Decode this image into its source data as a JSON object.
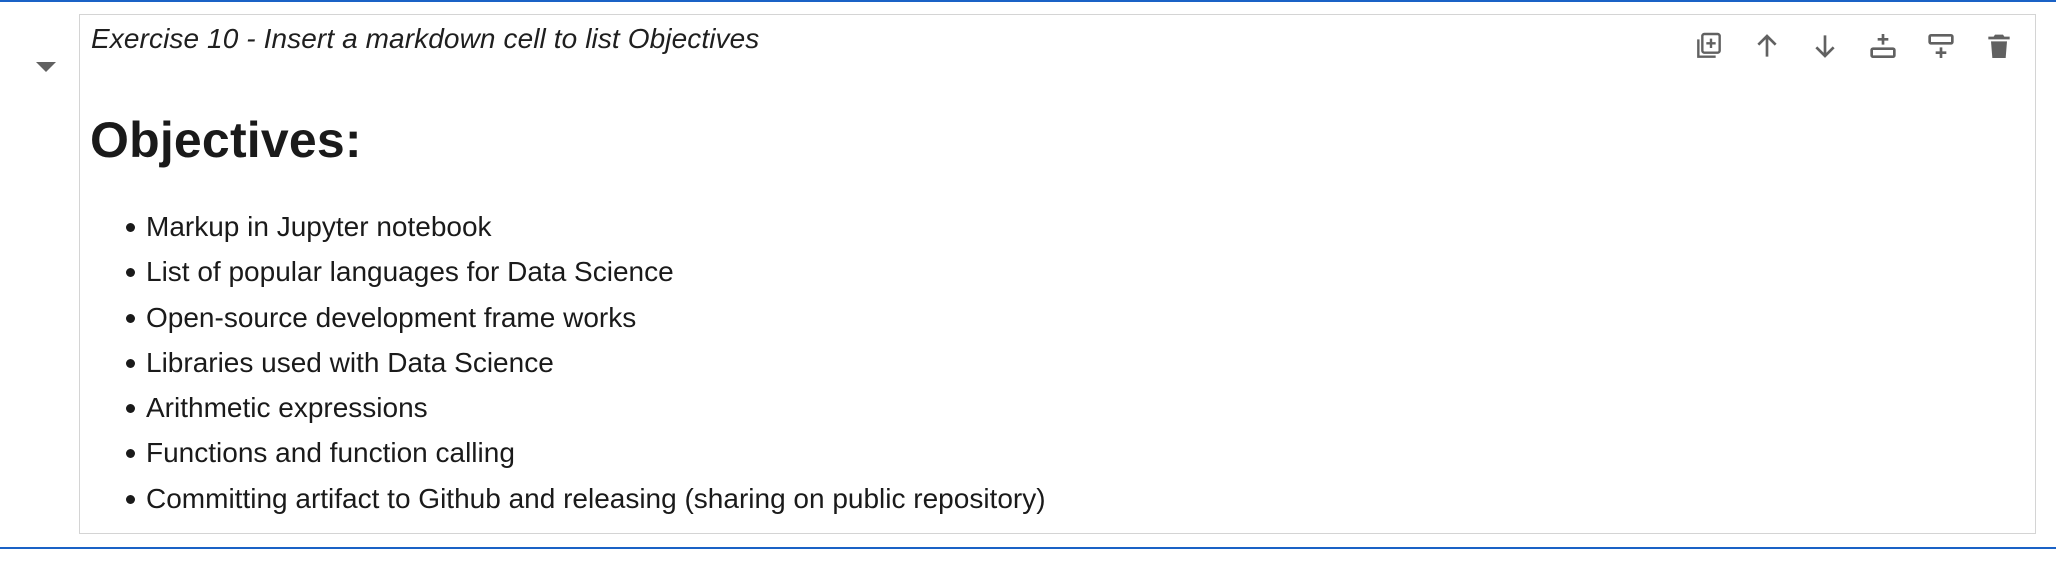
{
  "cell": {
    "heading": "Exercise 10 - Insert a markdown cell to list Objectives",
    "title": "Objectives:",
    "objectives": [
      "Markup in Jupyter notebook",
      "List of popular languages for Data Science",
      "Open-source development frame works",
      "Libraries used with Data Science",
      "Arithmetic expressions",
      "Functions and function calling",
      "Committing artifact to Github and releasing (sharing on public repository)"
    ]
  },
  "toolbar": {
    "icons": [
      "duplicate-icon",
      "arrow-up-icon",
      "arrow-down-icon",
      "insert-above-icon",
      "insert-below-icon",
      "trash-icon"
    ]
  },
  "colors": {
    "active_border": "#1a62c6",
    "cell_border": "#d4d4d4",
    "icon": "#616161"
  }
}
